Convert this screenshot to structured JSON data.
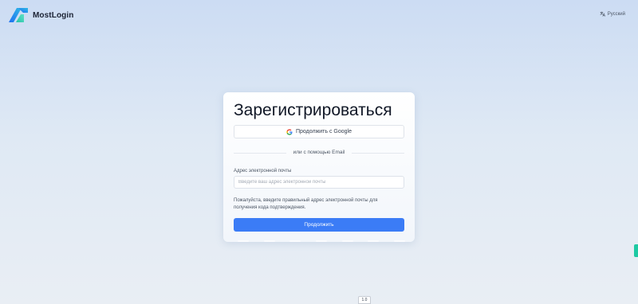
{
  "brand": {
    "name": "MostLogin",
    "logo_icon": "mostlogin-logo-icon"
  },
  "language": {
    "label": "Русский",
    "icon": "translate-icon"
  },
  "card": {
    "title": "Зарегистрироваться",
    "google_button_label": "Продолжить с Google",
    "divider_text": "или с помощью Email",
    "email_label": "Адрес электронной почты",
    "email_placeholder": "Введите ваш адрес электронной почты",
    "email_value": "",
    "hint": "Пожалуйста, введите правильный адрес электронной почты для получения кода подтверждения.",
    "submit_label": "Продолжить"
  },
  "footer_badge": "1.0",
  "colors": {
    "accent": "#3b7cf6",
    "side_tab": "#1ec9a3",
    "background_top": "#ccdcf3",
    "background_bottom": "#e9eef4"
  }
}
